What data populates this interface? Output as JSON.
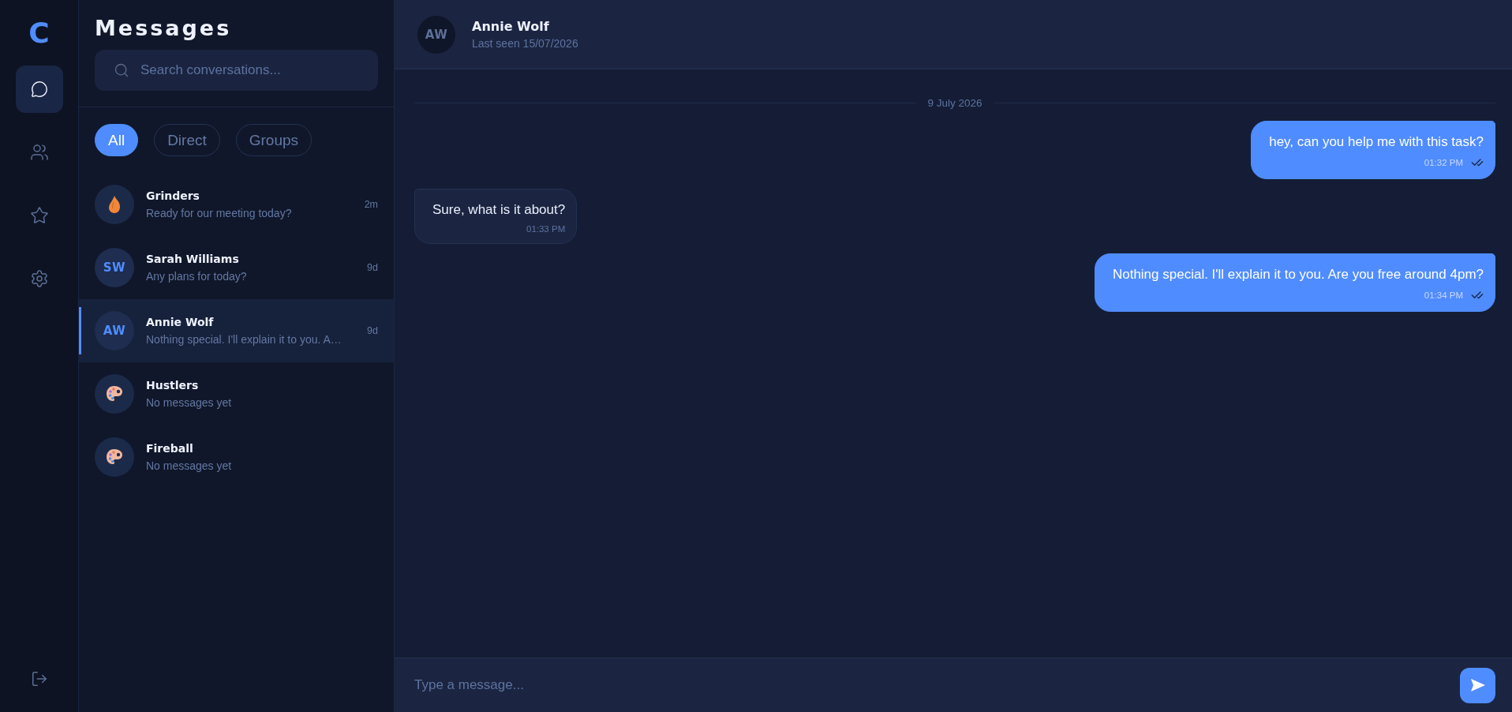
{
  "rail": {
    "logo": "C",
    "nav": [
      {
        "kind": "chats",
        "selected": true
      },
      {
        "kind": "contacts",
        "selected": false
      },
      {
        "kind": "favorites",
        "selected": false
      },
      {
        "kind": "settings",
        "selected": false
      }
    ],
    "bottom_nav": [
      {
        "kind": "logout"
      }
    ]
  },
  "sidebar": {
    "title": "Messages",
    "search": {
      "placeholder": "Search conversations..."
    },
    "filters": [
      {
        "label": "All",
        "selected": true
      },
      {
        "label": "Direct",
        "selected": false
      },
      {
        "label": "Groups",
        "selected": false
      }
    ],
    "conversations": [
      {
        "name": "Grinders",
        "preview": "Ready for our meeting today?",
        "time": "2m",
        "avatar": {
          "kind": "flame"
        },
        "selected": false
      },
      {
        "name": "Sarah Williams",
        "preview": "Any plans for today?",
        "time": "9d",
        "avatar": {
          "kind": "initials",
          "text": "SW"
        },
        "selected": false
      },
      {
        "name": "Annie Wolf",
        "preview": "Nothing special. I'll explain it to you. A…",
        "time": "9d",
        "avatar": {
          "kind": "initials",
          "text": "AW"
        },
        "selected": true
      },
      {
        "name": "Hustlers",
        "preview": "No messages yet",
        "avatar": {
          "kind": "palette"
        },
        "selected": false
      },
      {
        "name": "Fireball",
        "preview": "No messages yet",
        "avatar": {
          "kind": "palette"
        },
        "selected": false
      }
    ]
  },
  "chat": {
    "header": {
      "avatar": "AW",
      "name": "Annie Wolf",
      "status": "Last seen 15/07/2026"
    },
    "date": "9 July 2026",
    "messages": [
      {
        "kind": "outgoing",
        "text": "hey, can you help me with this task?",
        "time": "01:32 PM"
      },
      {
        "kind": "incoming",
        "text": "Sure, what is it about?",
        "time": "01:33 PM"
      },
      {
        "kind": "outgoing",
        "text": "Nothing special. I'll explain it to you. Are you free around 4pm?",
        "time": "01:34 PM"
      }
    ],
    "composer": {
      "placeholder": "Type a message..."
    }
  }
}
